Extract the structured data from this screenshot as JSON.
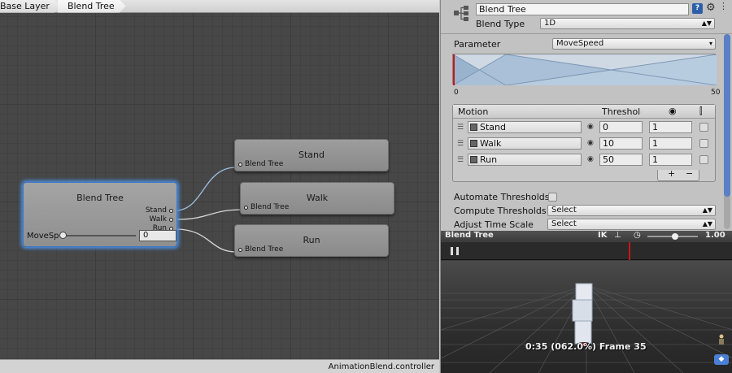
{
  "breadcrumb": {
    "items": [
      "Base Layer",
      "Blend Tree"
    ]
  },
  "footer": {
    "filename": "AnimationBlend.controller"
  },
  "graph": {
    "root_node": {
      "title": "Blend Tree",
      "outputs": [
        "Stand",
        "Walk",
        "Run"
      ],
      "param_name": "MoveSp",
      "param_value": "0",
      "slider_value": 0
    },
    "child_nodes": [
      {
        "title": "Stand",
        "input": "Blend Tree"
      },
      {
        "title": "Walk",
        "input": "Blend Tree"
      },
      {
        "title": "Run",
        "input": "Blend Tree"
      }
    ]
  },
  "inspector": {
    "name": "Blend Tree",
    "blend_type_label": "Blend Type",
    "blend_type_value": "1D",
    "parameter_label": "Parameter",
    "parameter_value": "MoveSpeed",
    "scale_min": "0",
    "scale_max": "50",
    "motion_list": {
      "headers": {
        "motion": "Motion",
        "threshold": "Threshold"
      },
      "rows": [
        {
          "motion": "Stand",
          "threshold": "0",
          "speed": "1"
        },
        {
          "motion": "Walk",
          "threshold": "10",
          "speed": "1"
        },
        {
          "motion": "Run",
          "threshold": "50",
          "speed": "1"
        }
      ],
      "add_label": "+",
      "remove_label": "−"
    },
    "automate_thresholds_label": "Automate Thresholds",
    "compute_thresholds_label": "Compute Thresholds",
    "compute_thresholds_value": "Select",
    "adjust_time_scale_label": "Adjust Time Scale",
    "adjust_time_scale_value": "Select"
  },
  "preview": {
    "title": "Blend Tree",
    "ik_label": "IK",
    "speed_value": "1.00",
    "frame_info": "0:35 (062.0%) Frame 35",
    "playhead_progress": 0.62
  },
  "colors": {
    "selection_glow": "#4d8fe0",
    "wire": "#c8c8c8",
    "threshold_marker": "#cc1515",
    "scrollbar": "#5a7fc4"
  }
}
